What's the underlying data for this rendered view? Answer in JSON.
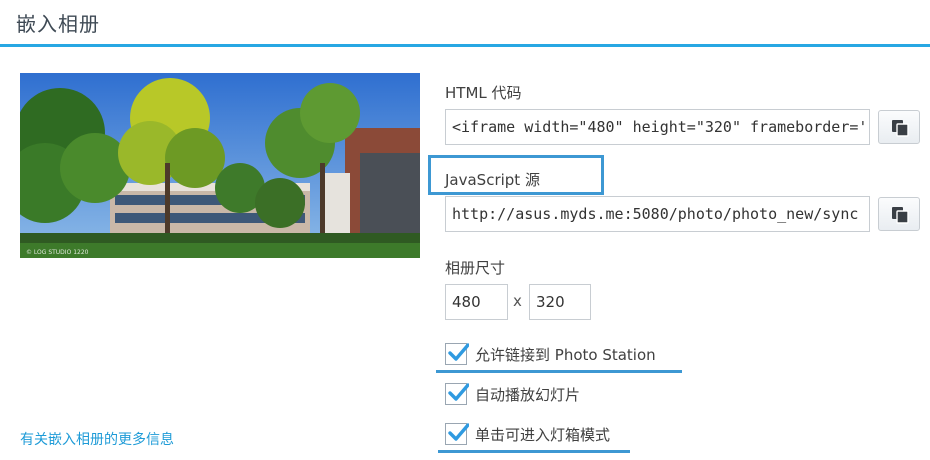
{
  "header": {
    "title": "嵌入相册"
  },
  "embed": {
    "html_label": "HTML 代码",
    "html_value": "<iframe width=\"480\" height=\"320\" frameborder='",
    "js_label": "JavaScript 源",
    "js_value": "http://asus.myds.me:5080/photo/photo_new/sync",
    "size_label": "相册尺寸",
    "width": "480",
    "times": "x",
    "height": "320"
  },
  "options": [
    {
      "label": "允许链接到 Photo Station",
      "checked": true
    },
    {
      "label": "自动播放幻灯片",
      "checked": true
    },
    {
      "label": "单击可进入灯箱模式",
      "checked": true
    }
  ],
  "preview": {
    "watermark": "© LOG STUDIO 1220"
  },
  "more_info_link": "有关嵌入相册的更多信息",
  "colors": {
    "accent": "#27a7e3",
    "link": "#1e9bd7",
    "highlight": "#3d98d3",
    "check": "#2f9ae0"
  }
}
